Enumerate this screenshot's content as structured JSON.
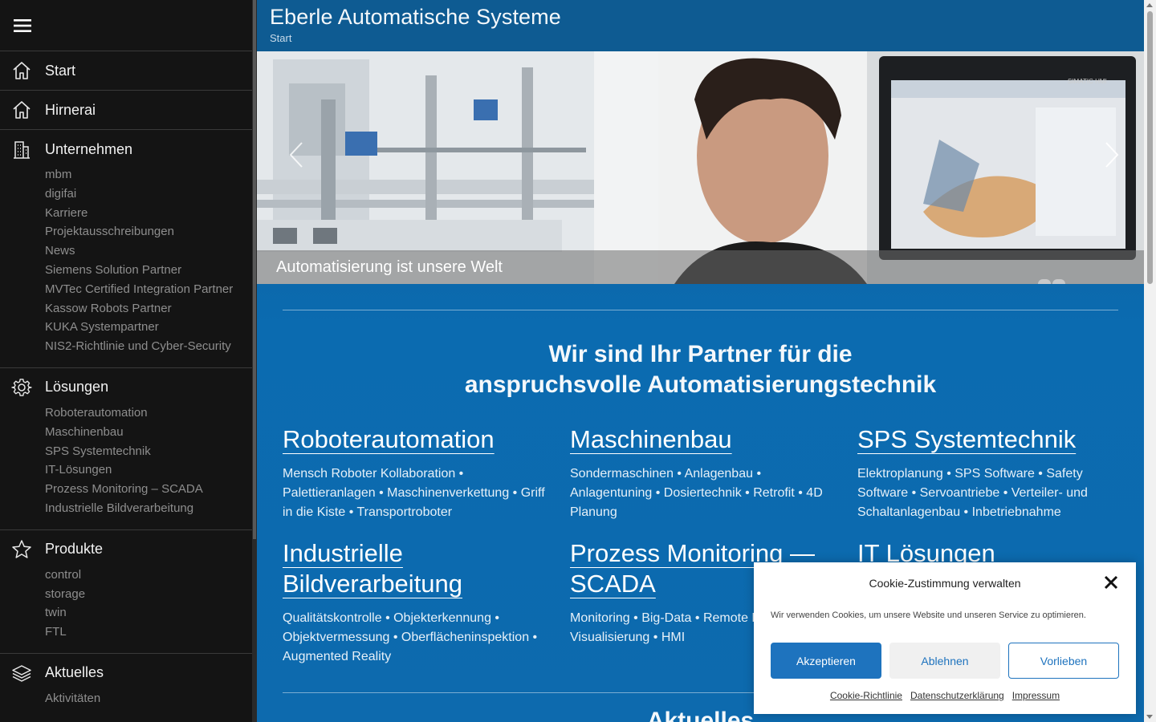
{
  "sidebar": {
    "sections": [
      {
        "label": "Start",
        "icon": "home-icon",
        "items": []
      },
      {
        "label": "Hirnerai",
        "icon": "home-icon",
        "items": []
      },
      {
        "label": "Unternehmen",
        "icon": "building-icon",
        "items": [
          "mbm",
          "digifai",
          "Karriere",
          "Projektausschreibungen",
          "News",
          "Siemens Solution Partner",
          "MVTec Certified Integration Partner",
          "Kassow Robots Partner",
          "KUKA Systempartner",
          "NIS2-Richtlinie und Cyber-Security"
        ]
      },
      {
        "label": "Lösungen",
        "icon": "gear-icon",
        "items": [
          "Roboterautomation",
          "Maschinenbau",
          "SPS Systemtechnik",
          "IT-Lösungen",
          "Prozess Monitoring – SCADA",
          "Industrielle Bildverarbeitung"
        ]
      },
      {
        "label": "Produkte",
        "icon": "star-icon",
        "items": [
          "control",
          "storage",
          "twin",
          "FTL"
        ]
      },
      {
        "label": "Aktuelles",
        "icon": "layers-icon",
        "items": [
          "Aktivitäten"
        ]
      }
    ]
  },
  "header": {
    "title": "Eberle Automatische Systeme",
    "breadcrumb": "Start"
  },
  "slider": {
    "caption": "Automatisierung ist unsere Welt",
    "screen_brand": "SIMATIC HMI"
  },
  "main": {
    "headline": "Wir sind Ihr Partner für die anspruchsvolle Automatisierungstechnik",
    "cards": [
      {
        "title": "Roboterautomation",
        "text": "Mensch Roboter Kollaboration • Palettieranlagen • Maschinenverkettung • Griff in die Kiste • Transportroboter"
      },
      {
        "title": "Maschinenbau",
        "text": "Sondermaschinen • Anlagenbau • Anlagentuning • Dosiertechnik • Retrofit • 4D Planung"
      },
      {
        "title": "SPS Systemtechnik",
        "text": "Elektroplanung • SPS Software • Safety Software • Servoantriebe • Verteiler- und Schaltanlagenbau • Inbetriebnahme"
      },
      {
        "title": "Industrielle Bildverarbeitung",
        "text": "Qualitätskontrolle • Objekterkennung • Objektvermessung • Oberflächeninspektion • Augmented Reality"
      },
      {
        "title": "Prozess Monitoring — SCADA",
        "text": "Monitoring • Big-Data • Remote L… Visualisierung • HMI"
      },
      {
        "title": "IT Lösungen",
        "text": ""
      }
    ],
    "section_heading": "Aktuelles"
  },
  "cookie": {
    "title": "Cookie-Zustimmung verwalten",
    "text": "Wir verwenden Cookies, um unsere Website und unseren Service zu optimieren.",
    "accept": "Akzeptieren",
    "deny": "Ablehnen",
    "prefs": "Vorlieben",
    "links": [
      "Cookie-Richtlinie",
      "Datenschutzerklärung",
      "Impressum"
    ]
  },
  "colors": {
    "sidebar_bg": "#141414",
    "main_bg": "#0d6aae",
    "header_bg": "#0e5b92",
    "accent": "#1e73be"
  }
}
